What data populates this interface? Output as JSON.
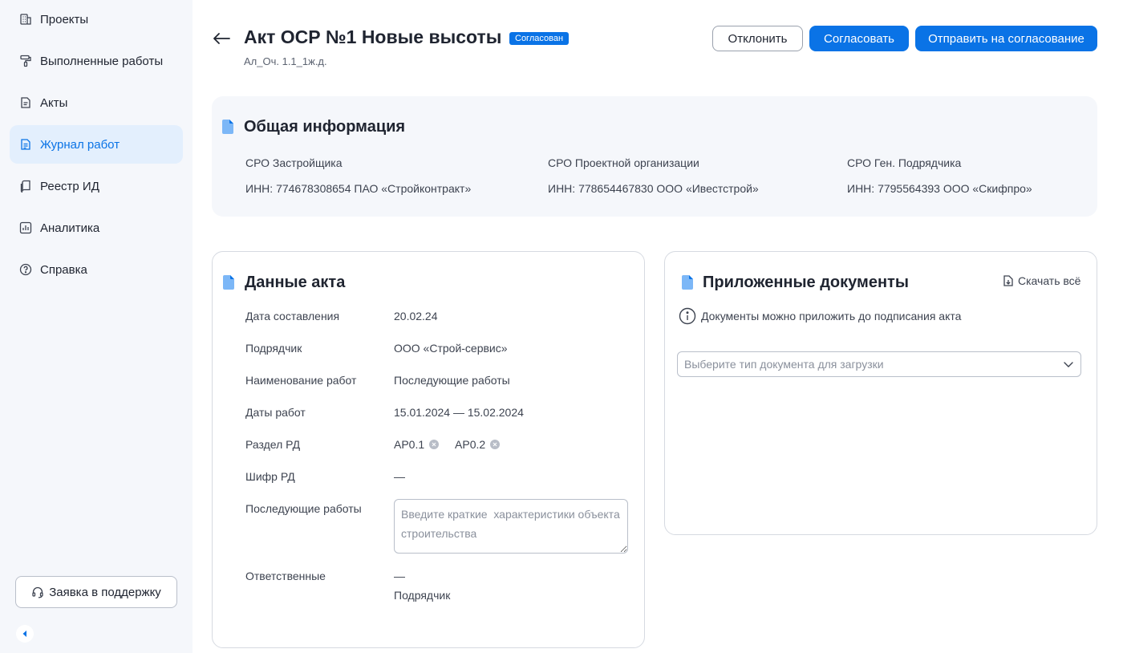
{
  "sidebar": {
    "items": [
      {
        "label": "Проекты",
        "icon": "building-icon"
      },
      {
        "label": "Выполненные работы",
        "icon": "roller-icon"
      },
      {
        "label": "Акты",
        "icon": "document-icon"
      },
      {
        "label": "Журнал работ",
        "icon": "journal-icon",
        "active": true
      },
      {
        "label": "Реестр ИД",
        "icon": "registry-icon"
      },
      {
        "label": "Аналитика",
        "icon": "chart-icon"
      },
      {
        "label": "Справка",
        "icon": "help-icon"
      }
    ],
    "support_label": "Заявка в поддержку"
  },
  "header": {
    "title": "Акт ОСР №1 Новые высоты",
    "status": "Согласован",
    "subtitle": "Ал_Оч. 1.1_1ж.д.",
    "reject_label": "Отклонить",
    "approve_label": "Согласовать",
    "send_label": "Отправить на согласование"
  },
  "general": {
    "title": "Общая информация",
    "columns": [
      {
        "label": "СРО Застройщика",
        "value": "ИНН: 774678308654 ПАО «Стройконтракт»"
      },
      {
        "label": "СРО Проектной организации",
        "value": "ИНН: 778654467830 ООО «Ивестстрой»"
      },
      {
        "label": "СРО Ген. Подрядчика",
        "value": "ИНН: 7795564393 ООО «Скифпро»"
      }
    ]
  },
  "act": {
    "title": "Данные акта",
    "rows": {
      "date": {
        "label": "Дата составления",
        "value": "20.02.24"
      },
      "contractor": {
        "label": "Подрядчик",
        "value": "ООО «Строй-сервис»"
      },
      "work_name": {
        "label": "Наименование работ",
        "value": "Последующие работы"
      },
      "work_dates": {
        "label": "Даты работ",
        "value": "15.01.2024 — 15.02.2024"
      },
      "section": {
        "label": "Раздел РД",
        "chips": [
          "АР0.1",
          "АР0.2"
        ]
      },
      "cipher": {
        "label": "Шифр РД",
        "value": "—"
      },
      "next_works": {
        "label": "Последующие работы",
        "placeholder": "Введите краткие  характеристики объекта строительства"
      },
      "responsible": {
        "label": "Ответственные",
        "value": "—",
        "role": "Подрядчик"
      }
    }
  },
  "docs": {
    "title": "Приложенные документы",
    "download_all": "Скачать всё",
    "note": "Документы можно приложить до подписания акта",
    "select_placeholder": "Выберите тип документа для загрузки"
  },
  "colors": {
    "accent": "#0a73e6",
    "active_bg": "#e3effd",
    "sidebar_bg": "#f5f7fb",
    "doc_icon": "#7cb7f7"
  }
}
